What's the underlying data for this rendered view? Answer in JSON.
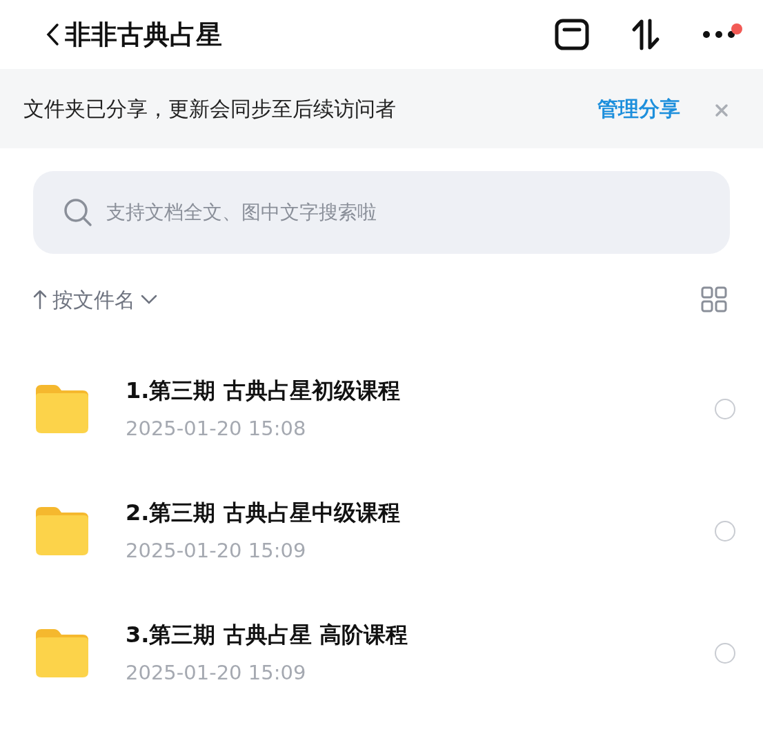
{
  "header": {
    "title": "非非古典占星",
    "notification_dot": true
  },
  "banner": {
    "text": "文件夹已分享，更新会同步至后续访问者",
    "action": "管理分享"
  },
  "search": {
    "placeholder": "支持文档全文、图中文字搜索啦"
  },
  "sort": {
    "label": "按文件名"
  },
  "files": [
    {
      "name": "1.第三期 古典占星初级课程",
      "time": "2025-01-20 15:08",
      "selected": false
    },
    {
      "name": "2.第三期 古典占星中级课程",
      "time": "2025-01-20 15:09",
      "selected": false
    },
    {
      "name": "3.第三期 古典占星 高阶课程",
      "time": "2025-01-20 15:09",
      "selected": false
    }
  ]
}
